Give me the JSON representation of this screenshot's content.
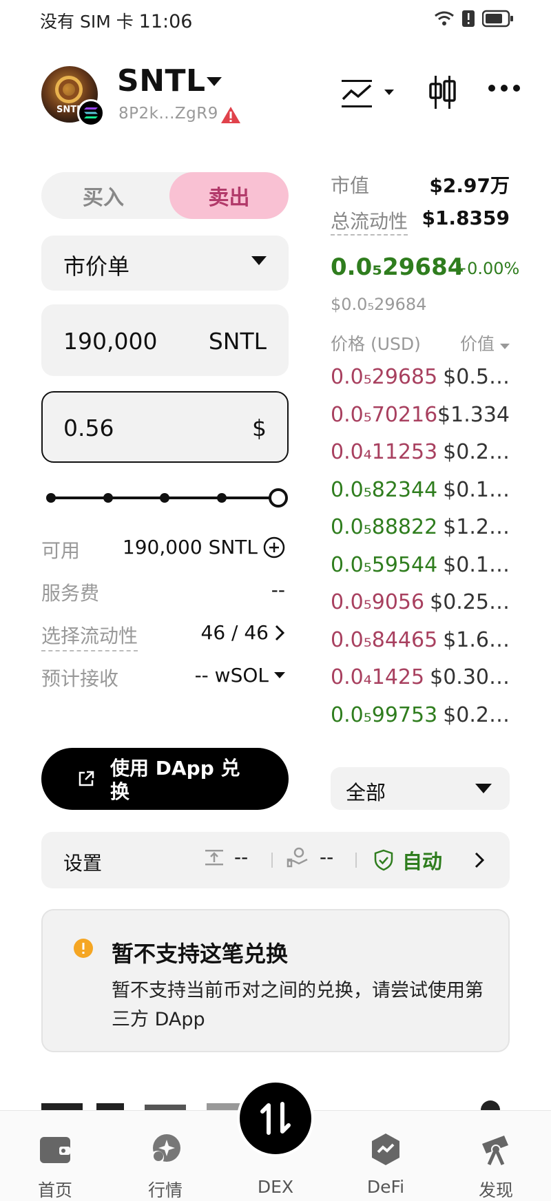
{
  "status_bar": {
    "carrier": "没有 SIM 卡",
    "time": "11:06"
  },
  "header": {
    "token_symbol": "SNTL",
    "address": "8P2k...ZgR9",
    "avatar_text": "SNTL"
  },
  "trade": {
    "buy_label": "买入",
    "sell_label": "卖出",
    "active_side": "sell",
    "order_type": "市价单",
    "amount_value": "190,000",
    "amount_unit": "SNTL",
    "price_value": "0.56",
    "price_unit": "$",
    "slider_level": 1.0,
    "available_label": "可用",
    "available_value": "190,000 SNTL",
    "fee_label": "服务费",
    "fee_value": "--",
    "liquidity_label": "选择流动性",
    "liquidity_value": "46 / 46",
    "receive_label": "预计接收",
    "receive_value": "-- wSOL",
    "dapp_button": "使用 DApp 兑换"
  },
  "market": {
    "mcap_label": "市值",
    "mcap_value": "$2.97万",
    "liquidity_label": "总流动性",
    "liquidity_value": "$1.8359",
    "price": "0.0₅29684",
    "change": "+0.00%",
    "price_usd": "$0.0₅29684",
    "col_price": "价格 (USD)",
    "col_value": "价值",
    "filter": "全部",
    "trades": [
      {
        "price": "0.0₅29685",
        "value": "$0.5…",
        "dir": "down"
      },
      {
        "price": "0.0₅70216",
        "value": "$1.334",
        "dir": "down"
      },
      {
        "price": "0.0₄11253",
        "value": "$0.2…",
        "dir": "down"
      },
      {
        "price": "0.0₅82344",
        "value": "$0.1…",
        "dir": "up"
      },
      {
        "price": "0.0₅88822",
        "value": "$1.2…",
        "dir": "up"
      },
      {
        "price": "0.0₅59544",
        "value": "$0.1…",
        "dir": "up"
      },
      {
        "price": "0.0₅9056",
        "value": "$0.25…",
        "dir": "down"
      },
      {
        "price": "0.0₅84465",
        "value": "$1.6…",
        "dir": "down"
      },
      {
        "price": "0.0₄1425",
        "value": "$0.30…",
        "dir": "down"
      },
      {
        "price": "0.0₅99753",
        "value": "$0.2…",
        "dir": "up"
      }
    ]
  },
  "settings": {
    "label": "设置",
    "slippage": "--",
    "gas": "--",
    "mev": "自动"
  },
  "warning": {
    "title": "暂不支持这笔兑换",
    "body": "暂不支持当前币对之间的兑换，请尝试使用第三方 DApp"
  },
  "nav": {
    "home": "首页",
    "market": "行情",
    "dex": "DEX",
    "defi": "DeFi",
    "discover": "发现"
  },
  "colors": {
    "up": "#2f7d1e",
    "down": "#a8405f",
    "sell_pill": "#f9c1d3"
  }
}
